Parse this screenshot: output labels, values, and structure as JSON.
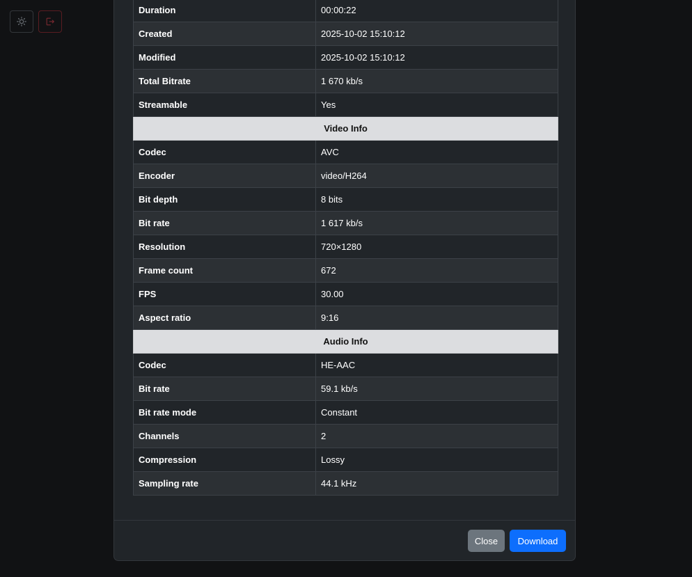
{
  "colors": {
    "background": "#111214",
    "modal": "#212529",
    "row_striped": "#2c3034",
    "section_header": "#dcdde0",
    "close_button": "#6c757d",
    "download_button": "#0d6efd",
    "logout_icon": "#dc3545"
  },
  "top_controls": {
    "theme_icon": "sun-icon",
    "logout_icon": "logout-icon"
  },
  "general_rows": [
    {
      "key": "Duration",
      "value": "00:00:22"
    },
    {
      "key": "Created",
      "value": "2025-10-02 15:10:12"
    },
    {
      "key": "Modified",
      "value": "2025-10-02 15:10:12"
    },
    {
      "key": "Total Bitrate",
      "value": "1 670 kb/s"
    },
    {
      "key": "Streamable",
      "value": "Yes"
    }
  ],
  "video_section": {
    "title": "Video Info",
    "rows": [
      {
        "key": "Codec",
        "value": "AVC"
      },
      {
        "key": "Encoder",
        "value": "video/H264"
      },
      {
        "key": "Bit depth",
        "value": "8 bits"
      },
      {
        "key": "Bit rate",
        "value": "1 617 kb/s"
      },
      {
        "key": "Resolution",
        "value": "720×1280"
      },
      {
        "key": "Frame count",
        "value": "672"
      },
      {
        "key": "FPS",
        "value": "30.00"
      },
      {
        "key": "Aspect ratio",
        "value": "9:16"
      }
    ]
  },
  "audio_section": {
    "title": "Audio Info",
    "rows": [
      {
        "key": "Codec",
        "value": "HE-AAC"
      },
      {
        "key": "Bit rate",
        "value": "59.1 kb/s"
      },
      {
        "key": "Bit rate mode",
        "value": "Constant"
      },
      {
        "key": "Channels",
        "value": "2"
      },
      {
        "key": "Compression",
        "value": "Lossy"
      },
      {
        "key": "Sampling rate",
        "value": "44.1 kHz"
      }
    ]
  },
  "footer": {
    "close_label": "Close",
    "download_label": "Download"
  }
}
